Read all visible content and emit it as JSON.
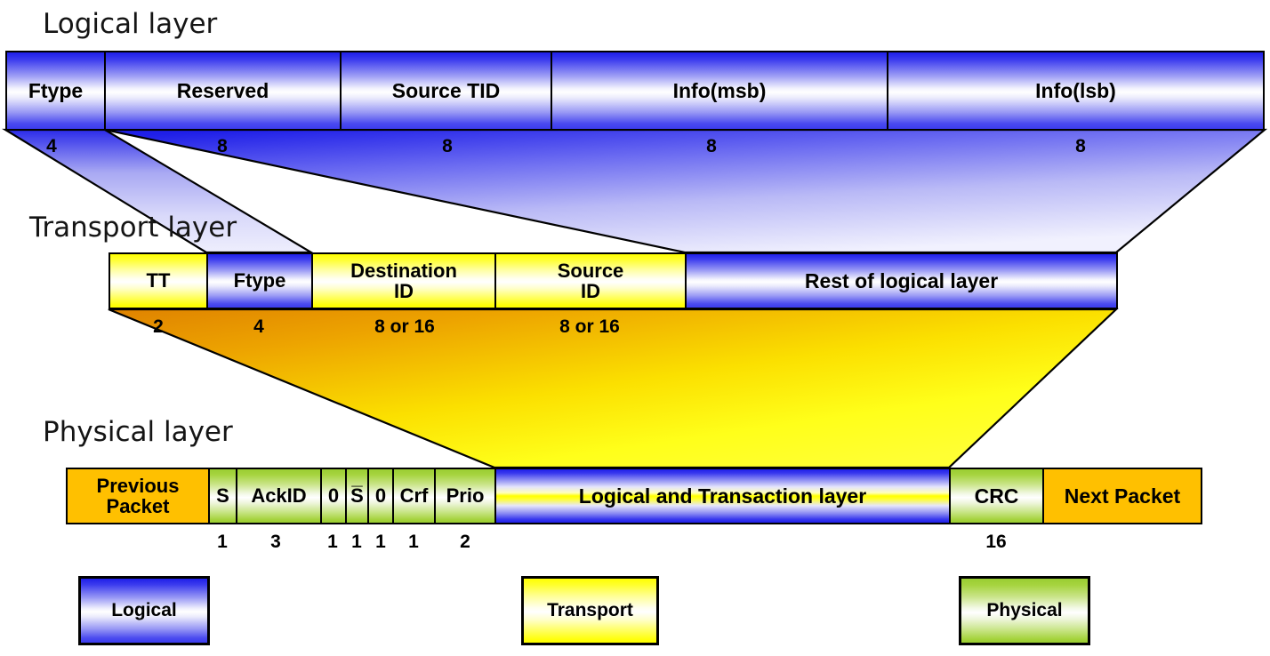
{
  "headings": {
    "logical": "Logical layer",
    "transport": "Transport layer",
    "physical": "Physical layer"
  },
  "logical_layer": {
    "fields": [
      {
        "label": "Ftype",
        "bits": "4"
      },
      {
        "label": "Reserved",
        "bits": "8"
      },
      {
        "label": "Source TID",
        "bits": "8"
      },
      {
        "label": "Info(msb)",
        "bits": "8"
      },
      {
        "label": "Info(lsb)",
        "bits": "8"
      }
    ]
  },
  "transport_layer": {
    "fields": [
      {
        "label": "TT",
        "bits": "2"
      },
      {
        "label": "Ftype",
        "bits": "4"
      },
      {
        "label": "Destination\nID",
        "line1": "Destination",
        "line2": "ID",
        "bits": "8 or 16"
      },
      {
        "label": "Source\nID",
        "line1": "Source",
        "line2": "ID",
        "bits": "8 or 16"
      },
      {
        "label": "Rest of logical layer",
        "bits": ""
      }
    ]
  },
  "physical_layer": {
    "fields": [
      {
        "label": "Previous Packet",
        "line1": "Previous",
        "line2": "Packet",
        "bits": ""
      },
      {
        "label": "S",
        "bits": "1"
      },
      {
        "label": "AckID",
        "bits": "3"
      },
      {
        "label": "0",
        "bits": "1"
      },
      {
        "label": "S̅",
        "bits": "1"
      },
      {
        "label": "0",
        "bits": "1"
      },
      {
        "label": "Crf",
        "bits": "1"
      },
      {
        "label": "Prio",
        "bits": "2"
      },
      {
        "label": "Logical and Transaction layer",
        "bits": ""
      },
      {
        "label": "CRC",
        "bits": "16"
      },
      {
        "label": "Next Packet",
        "bits": ""
      }
    ]
  },
  "legend": {
    "items": [
      {
        "label": "Logical",
        "color": "#3a3aee"
      },
      {
        "label": "Transport",
        "color": "#ffff00"
      },
      {
        "label": "Physical",
        "color": "#9acd32"
      }
    ]
  }
}
